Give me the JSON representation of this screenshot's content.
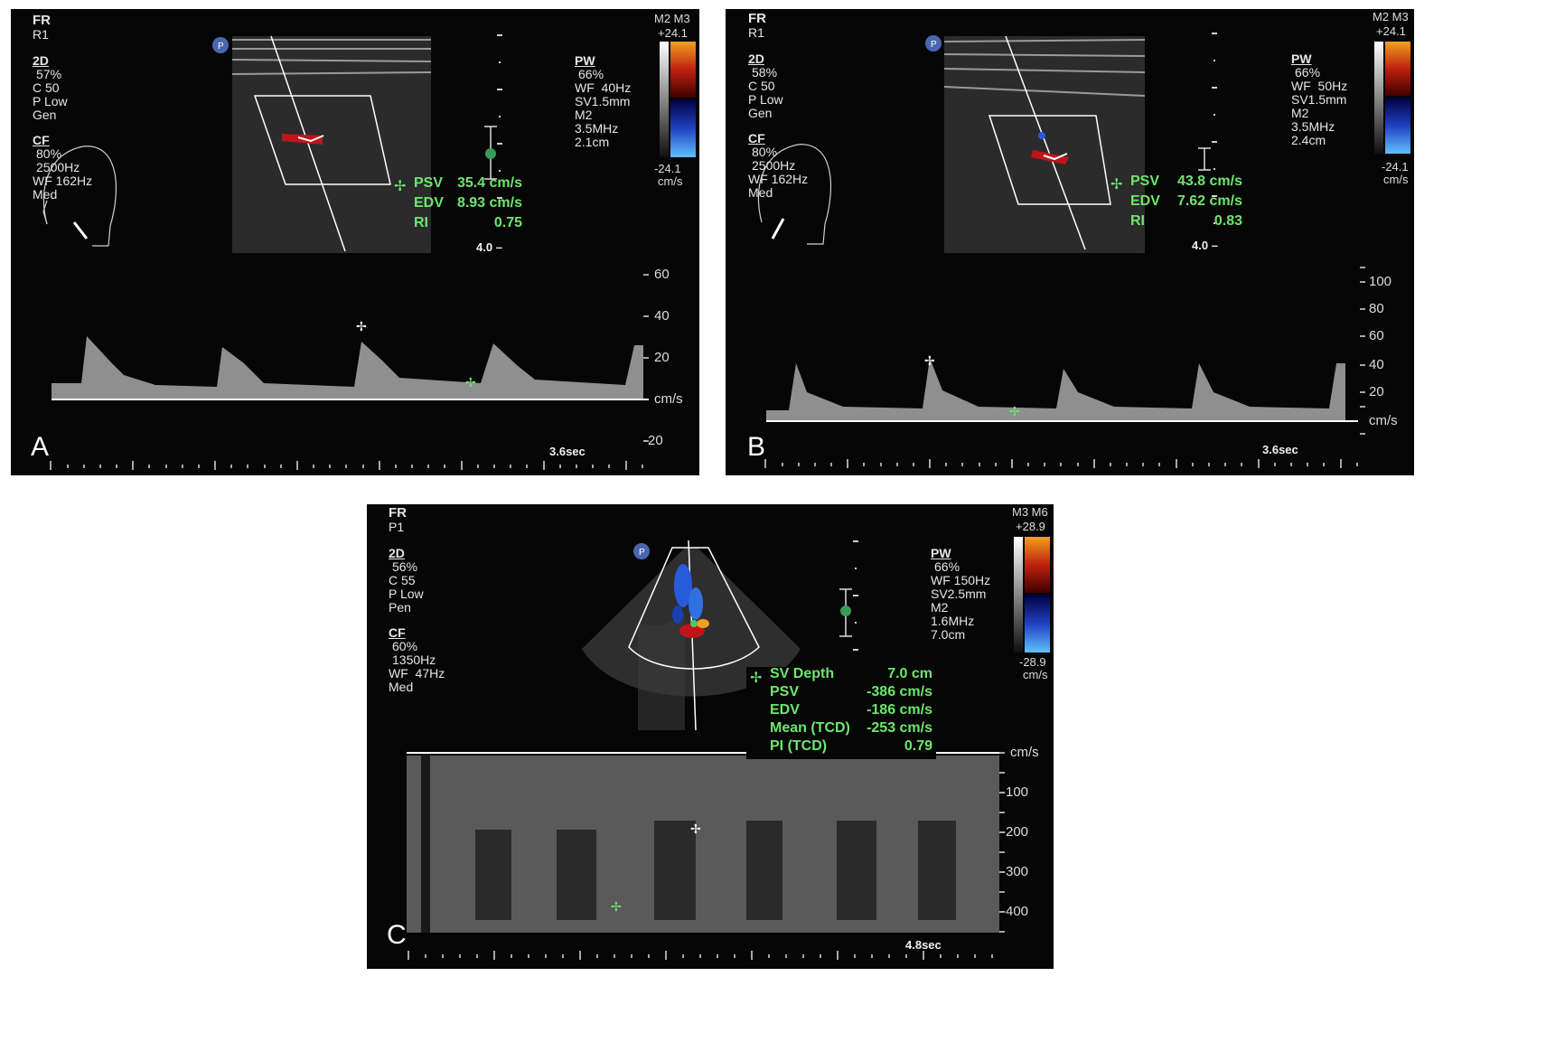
{
  "panels": {
    "A": {
      "letter": "A",
      "header": "FR",
      "mode": "R1",
      "2d": {
        "title": "2D",
        "gain": "57%",
        "c": "C 50",
        "power": "P Low",
        "preset": "Gen"
      },
      "cf": {
        "title": "CF",
        "gain": "80%",
        "prf": "2500Hz",
        "wf": "WF 162Hz",
        "mode": "Med"
      },
      "pw": {
        "title": "PW",
        "gain": "66%",
        "wf": "WF  40Hz",
        "sv": "SV1.5mm",
        "m": "M2",
        "freq": "3.5MHz",
        "depth": "2.1cm"
      },
      "colorbar": {
        "label": "M2 M3",
        "top": "+24.1",
        "bottom": "-24.1",
        "unit": "cm/s"
      },
      "measurements": [
        {
          "key": "PSV",
          "value": "35.4 cm/s"
        },
        {
          "key": "EDV",
          "value": "8.93 cm/s"
        },
        {
          "key": "RI",
          "value": "0.75"
        }
      ],
      "depth_mark": "4.0",
      "scale_ticks": [
        "60",
        "40",
        "20",
        "cm/s",
        "-20"
      ],
      "sweep_time": "3.6sec"
    },
    "B": {
      "letter": "B",
      "header": "FR",
      "mode": "R1",
      "2d": {
        "title": "2D",
        "gain": "58%",
        "c": "C 50",
        "power": "P Low",
        "preset": "Gen"
      },
      "cf": {
        "title": "CF",
        "gain": "80%",
        "prf": "2500Hz",
        "wf": "WF 162Hz",
        "mode": "Med"
      },
      "pw": {
        "title": "PW",
        "gain": "66%",
        "wf": "WF  50Hz",
        "sv": "SV1.5mm",
        "m": "M2",
        "freq": "3.5MHz",
        "depth": "2.4cm"
      },
      "colorbar": {
        "label": "M2 M3",
        "top": "+24.1",
        "bottom": "-24.1",
        "unit": "cm/s"
      },
      "measurements": [
        {
          "key": "PSV",
          "value": "43.8 cm/s"
        },
        {
          "key": "EDV",
          "value": "7.62 cm/s"
        },
        {
          "key": "RI",
          "value": "0.83"
        }
      ],
      "depth_mark": "4.0",
      "scale_ticks": [
        "100",
        "80",
        "60",
        "40",
        "20",
        "cm/s"
      ],
      "sweep_time": "3.6sec"
    },
    "C": {
      "letter": "C",
      "header": "FR",
      "mode": "P1",
      "2d": {
        "title": "2D",
        "gain": "56%",
        "c": "C 55",
        "power": "P Low",
        "preset": "Pen"
      },
      "cf": {
        "title": "CF",
        "gain": "60%",
        "prf": "1350Hz",
        "wf": "WF  47Hz",
        "mode": "Med"
      },
      "pw": {
        "title": "PW",
        "gain": "66%",
        "wf": "WF 150Hz",
        "sv": "SV2.5mm",
        "m": "M2",
        "freq": "1.6MHz",
        "depth": "7.0cm"
      },
      "colorbar": {
        "label": "M3 M6",
        "top": "+28.9",
        "bottom": "-28.9",
        "unit": "cm/s"
      },
      "measurements": [
        {
          "key": "SV Depth",
          "value": "7.0 cm"
        },
        {
          "key": "PSV",
          "value": "-386 cm/s"
        },
        {
          "key": "EDV",
          "value": "-186 cm/s"
        },
        {
          "key": "Mean (TCD)",
          "value": "-253 cm/s"
        },
        {
          "key": "PI (TCD)",
          "value": "0.79"
        }
      ],
      "scale_ticks": [
        "cm/s",
        "-100",
        "-200",
        "-300",
        "-400"
      ],
      "sweep_time": "4.8sec"
    }
  },
  "colors": {
    "measure": "#6ee66e",
    "background": "#060606",
    "flow_red": "#c0141a",
    "flow_blue": "#2a5adc"
  }
}
